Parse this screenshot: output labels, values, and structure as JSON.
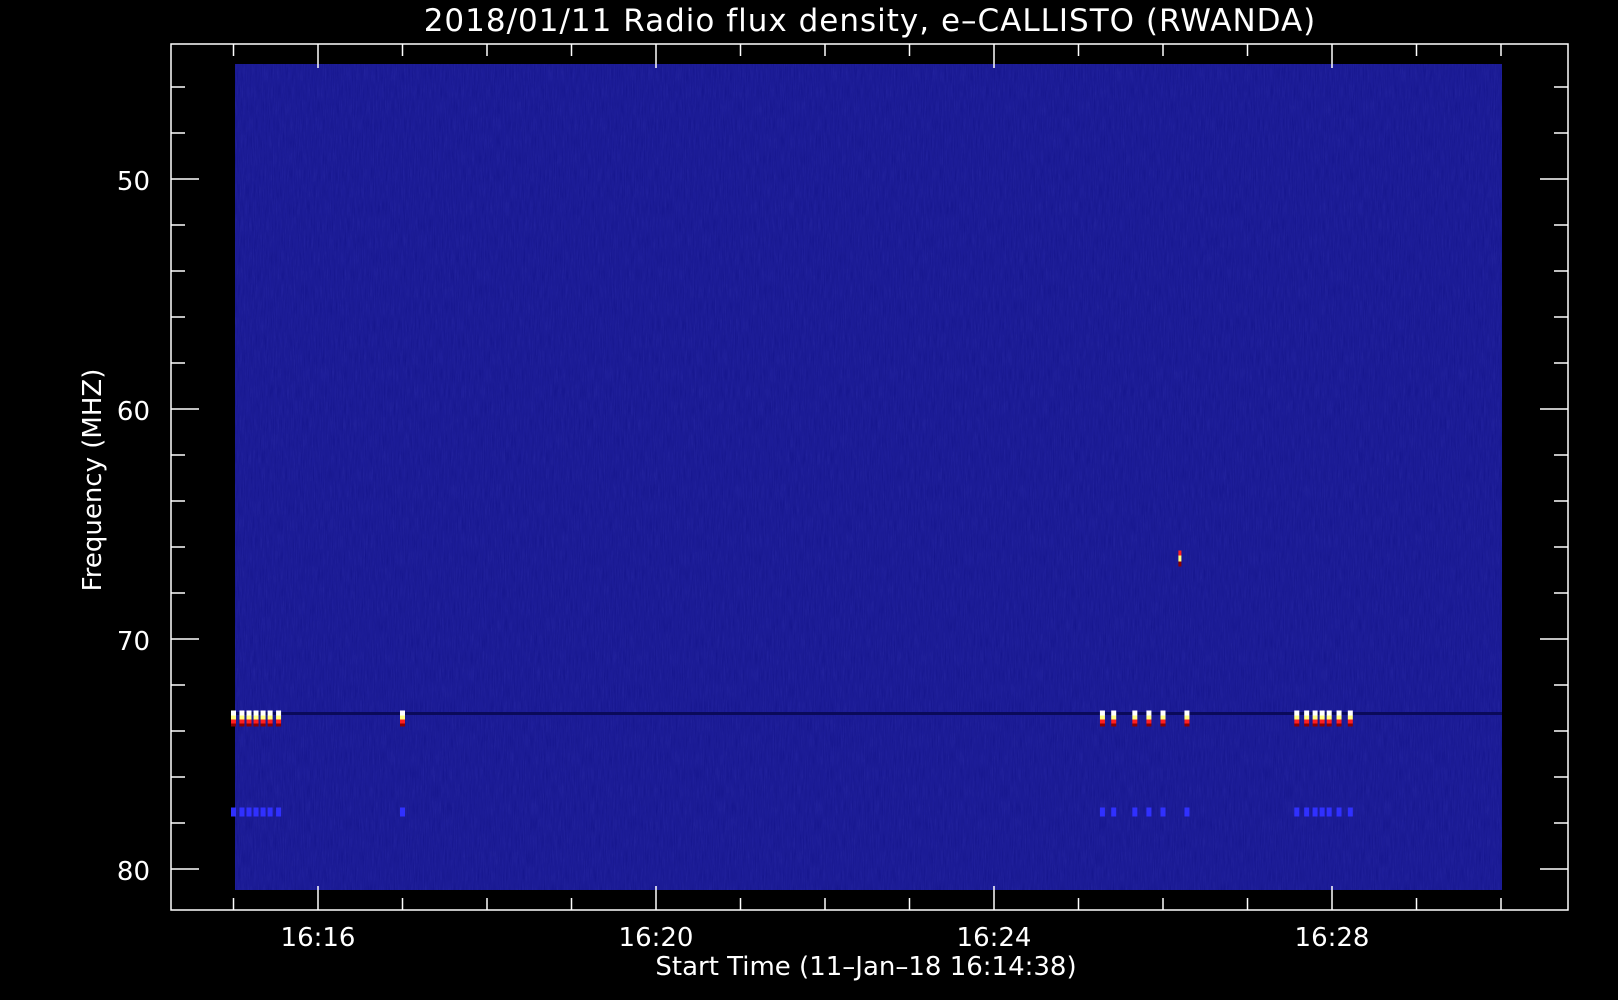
{
  "chart_data": {
    "type": "heatmap",
    "title": "2018/01/11  Radio flux density, e–CALLISTO (RWANDA)",
    "xlabel": "Start Time (11–Jan–18 16:14:38)",
    "ylabel": "Frequency (MHZ)",
    "x_tick_labels": [
      "16:16",
      "16:20",
      "16:24",
      "16:28"
    ],
    "y_tick_labels": [
      "50",
      "60",
      "70",
      "80"
    ],
    "y_tick_values": [
      50,
      60,
      70,
      80
    ],
    "y_inverted": true,
    "colors": {
      "background": "#000000",
      "spectrogram_base": "#14148c",
      "burst_hot": "#ffff80",
      "burst_warm": "#ffffff",
      "burst_red": "#ff2020",
      "burst_dark": "#8c0000",
      "harmonic": "#3030ff"
    },
    "interference": [
      {
        "t": "16:15:00",
        "f": 73.5
      },
      {
        "t": "16:15:06",
        "f": 73.5
      },
      {
        "t": "16:15:11",
        "f": 73.5
      },
      {
        "t": "16:15:16",
        "f": 73.5
      },
      {
        "t": "16:15:21",
        "f": 73.5
      },
      {
        "t": "16:15:26",
        "f": 73.5
      },
      {
        "t": "16:15:32",
        "f": 73.5
      },
      {
        "t": "16:17:00",
        "f": 73.5
      },
      {
        "t": "16:25:17",
        "f": 73.5
      },
      {
        "t": "16:25:25",
        "f": 73.5
      },
      {
        "t": "16:25:40",
        "f": 73.5
      },
      {
        "t": "16:25:50",
        "f": 73.5
      },
      {
        "t": "16:26:00",
        "f": 73.5
      },
      {
        "t": "16:26:17",
        "f": 73.5
      },
      {
        "t": "16:27:35",
        "f": 73.5
      },
      {
        "t": "16:27:42",
        "f": 73.5
      },
      {
        "t": "16:27:48",
        "f": 73.5
      },
      {
        "t": "16:27:53",
        "f": 73.5
      },
      {
        "t": "16:27:58",
        "f": 73.5
      },
      {
        "t": "16:28:05",
        "f": 73.5
      },
      {
        "t": "16:28:13",
        "f": 73.5
      }
    ],
    "spike": {
      "t": "16:26:12",
      "f": 66.5
    }
  }
}
